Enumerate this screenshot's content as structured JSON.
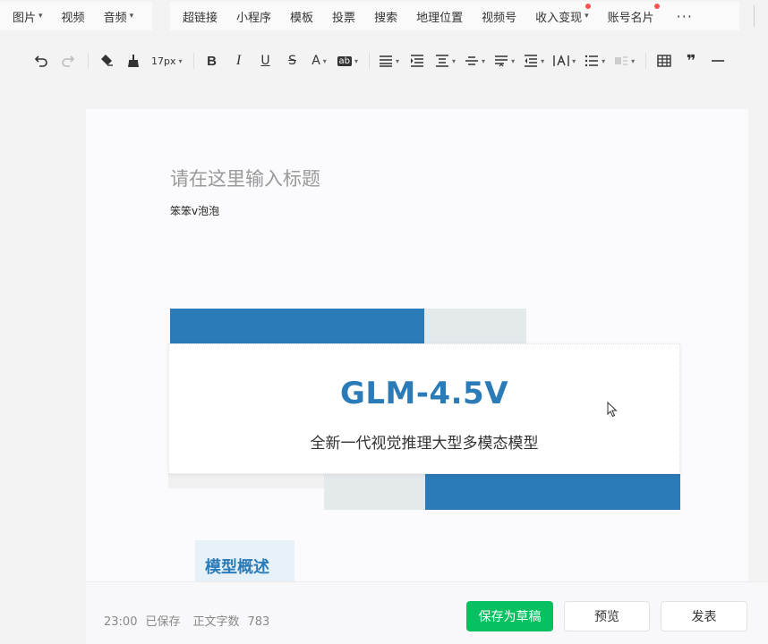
{
  "menubar": {
    "group1": [
      {
        "label": "图片",
        "caret": true,
        "dot": false
      },
      {
        "label": "视频",
        "caret": false,
        "dot": false
      },
      {
        "label": "音频",
        "caret": true,
        "dot": false
      }
    ],
    "group2": [
      {
        "label": "超链接",
        "caret": false,
        "dot": false
      },
      {
        "label": "小程序",
        "caret": false,
        "dot": false
      },
      {
        "label": "模板",
        "caret": false,
        "dot": false
      },
      {
        "label": "投票",
        "caret": false,
        "dot": false
      },
      {
        "label": "搜索",
        "caret": false,
        "dot": false
      },
      {
        "label": "地理位置",
        "caret": false,
        "dot": false
      },
      {
        "label": "视频号",
        "caret": false,
        "dot": false
      },
      {
        "label": "收入变现",
        "caret": true,
        "dot": true
      },
      {
        "label": "账号名片",
        "caret": false,
        "dot": true
      }
    ],
    "more_label": "···"
  },
  "toolbar": {
    "font_size": "17px",
    "bold": "B",
    "italic": "I",
    "underline": "U",
    "strike": "S",
    "font_color": "A",
    "bg_color": "ab",
    "quote": "❞"
  },
  "editor": {
    "title_placeholder": "请在这里输入标题",
    "author": "笨笨v泡泡",
    "banner_title": "GLM-4.5V",
    "banner_subtitle": "全新一代视觉推理大型多模态模型",
    "section_heading": "模型概述"
  },
  "footer": {
    "time": "23:00",
    "saved": "已保存",
    "word_count_label": "正文字数",
    "word_count": "783",
    "save_draft": "保存为草稿",
    "preview": "预览",
    "publish": "发表"
  },
  "colors": {
    "accent_blue": "#2a7bb8",
    "draft_green": "#07c160",
    "badge_red": "#fa5151"
  }
}
